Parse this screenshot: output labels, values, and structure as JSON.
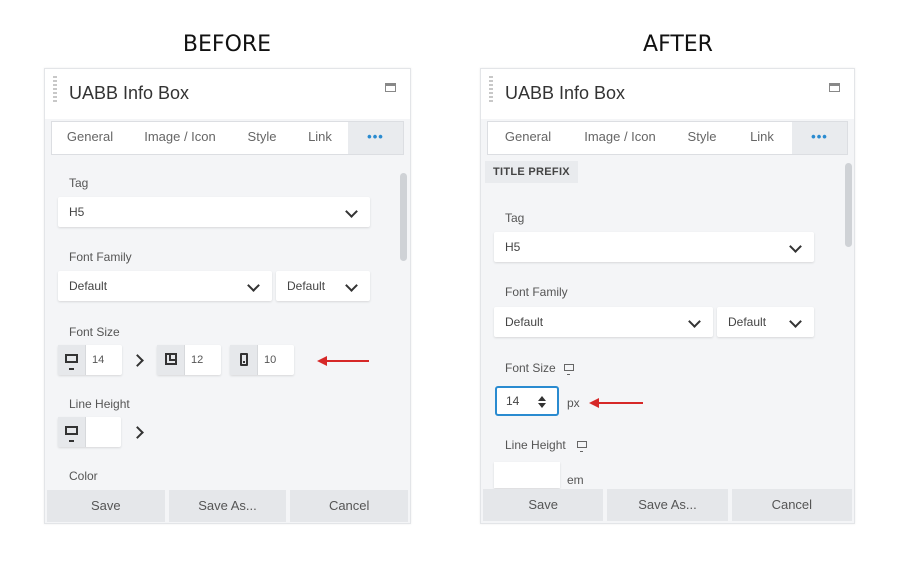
{
  "captions": {
    "before": "BEFORE",
    "after": "AFTER"
  },
  "panel_title": "UABB Info Box",
  "tabs": [
    "General",
    "Image / Icon",
    "Style",
    "Link",
    "•••"
  ],
  "before": {
    "tag_label": "Tag",
    "tag_value": "H5",
    "font_family_label": "Font Family",
    "font_family_value": "Default",
    "font_weight_value": "Default",
    "font_size_label": "Font Size",
    "font_size_desktop": "14",
    "font_size_tablet": "12",
    "font_size_mobile": "10",
    "line_height_label": "Line Height",
    "color_label": "Color"
  },
  "after": {
    "section_label": "TITLE PREFIX",
    "tag_label": "Tag",
    "tag_value": "H5",
    "font_family_label": "Font Family",
    "font_family_value": "Default",
    "font_weight_value": "Default",
    "font_size_label": "Font Size",
    "font_size_value": "14",
    "font_size_unit": "px",
    "line_height_label": "Line Height",
    "line_height_unit": "em"
  },
  "footer": {
    "save": "Save",
    "save_as": "Save As...",
    "cancel": "Cancel"
  },
  "colors": {
    "accent": "#2a8bd0",
    "annotation_arrow": "#d62828",
    "panel_bg": "#f4f5f7"
  }
}
